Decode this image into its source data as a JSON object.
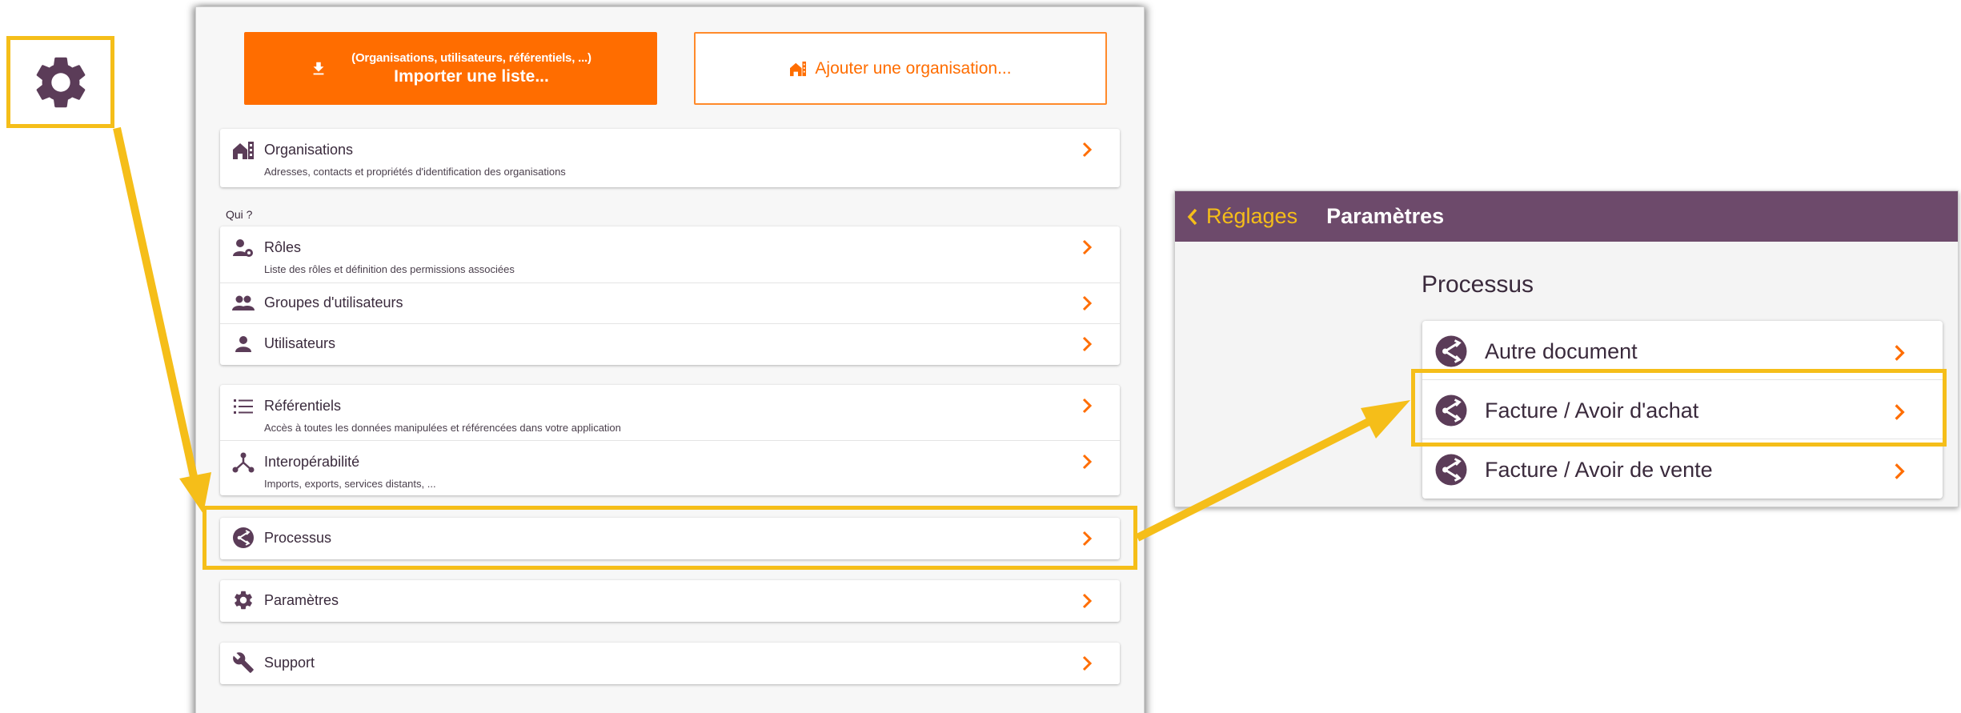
{
  "colors": {
    "accent": "#ff6d00",
    "highlight": "#f5be19",
    "header": "#6d4a6b",
    "icon": "#5b3c58"
  },
  "toolbar": {
    "import_sublabel": "(Organisations, utilisateurs, référentiels, ...)",
    "import_label": "Importer une liste...",
    "add_org_label": "Ajouter une organisation..."
  },
  "menu": {
    "organisations": {
      "title": "Organisations",
      "desc": "Adresses, contacts et propriétés d'identification des organisations"
    },
    "who_label": "Qui ?",
    "roles": {
      "title": "Rôles",
      "desc": "Liste des rôles et définition des permissions associées"
    },
    "groups": {
      "title": "Groupes d'utilisateurs"
    },
    "users": {
      "title": "Utilisateurs"
    },
    "referentials": {
      "title": "Référentiels",
      "desc": "Accès à toutes les données manipulées et référencées dans votre application"
    },
    "interop": {
      "title": "Interopérabilité",
      "desc": "Imports, exports, services distants, ..."
    },
    "process": {
      "title": "Processus"
    },
    "params": {
      "title": "Paramètres"
    },
    "support": {
      "title": "Support"
    }
  },
  "detail": {
    "back_label": "Réglages",
    "title": "Paramètres",
    "section": "Processus",
    "items": [
      {
        "label": "Autre document"
      },
      {
        "label": "Facture / Avoir d'achat"
      },
      {
        "label": "Facture / Avoir de vente"
      }
    ]
  }
}
